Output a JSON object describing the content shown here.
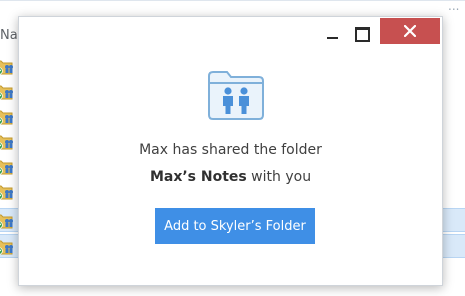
{
  "background": {
    "column_header": "Na",
    "ellipsis": "...",
    "rows": [
      {
        "selected": false
      },
      {
        "selected": false
      },
      {
        "selected": false
      },
      {
        "selected": false
      },
      {
        "selected": false
      },
      {
        "selected": false
      },
      {
        "selected": true
      },
      {
        "selected": true
      }
    ]
  },
  "dialog": {
    "controls": {
      "minimize_icon": "minimize-icon",
      "maximize_icon": "maximize-icon",
      "close_icon": "close-icon",
      "close_color": "#c75050"
    },
    "icon": "shared-folder-icon",
    "message_line1": "Max has shared the folder",
    "folder_name": "Max’s Notes",
    "message_suffix": " with you",
    "button_label": "Add to Skyler’s Folder",
    "accent_color": "#3f8fe6"
  }
}
